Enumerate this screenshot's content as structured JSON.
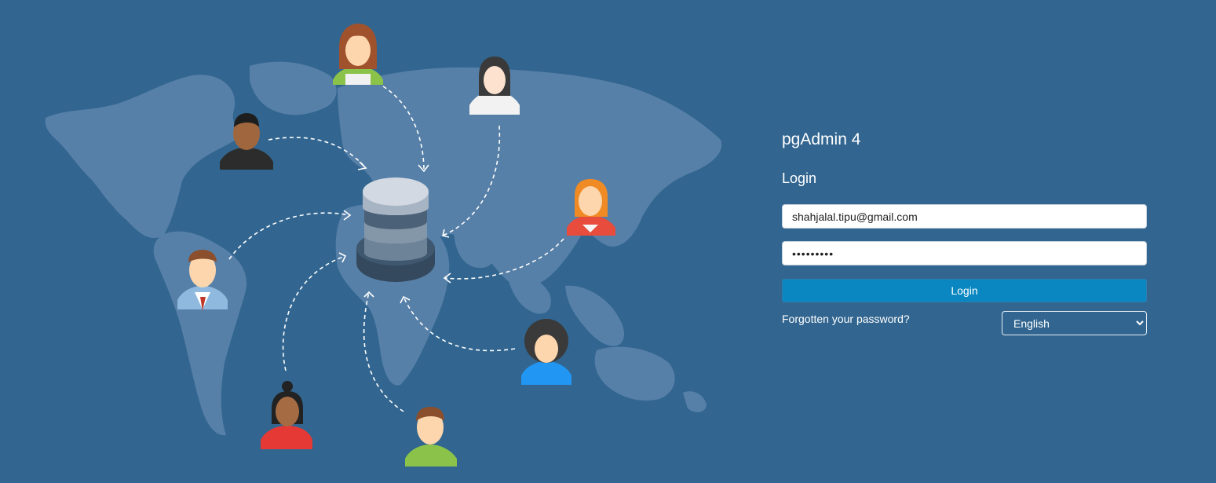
{
  "app": {
    "title": "pgAdmin 4"
  },
  "login": {
    "heading": "Login",
    "email_value": "shahjalal.tipu@gmail.com",
    "password_value": "•••••••••",
    "button_label": "Login",
    "forgot_label": "Forgotten your password?",
    "language": {
      "selected": "English",
      "options": [
        "English"
      ]
    }
  },
  "colors": {
    "background": "#326690",
    "map": "#5b84ab",
    "button": "#0a87c0",
    "database_top": "#c7d0dc",
    "database_dark": "#34495e"
  },
  "illustration": {
    "icons": [
      "world-map-icon",
      "database-icon",
      "user-avatar-icon"
    ]
  }
}
